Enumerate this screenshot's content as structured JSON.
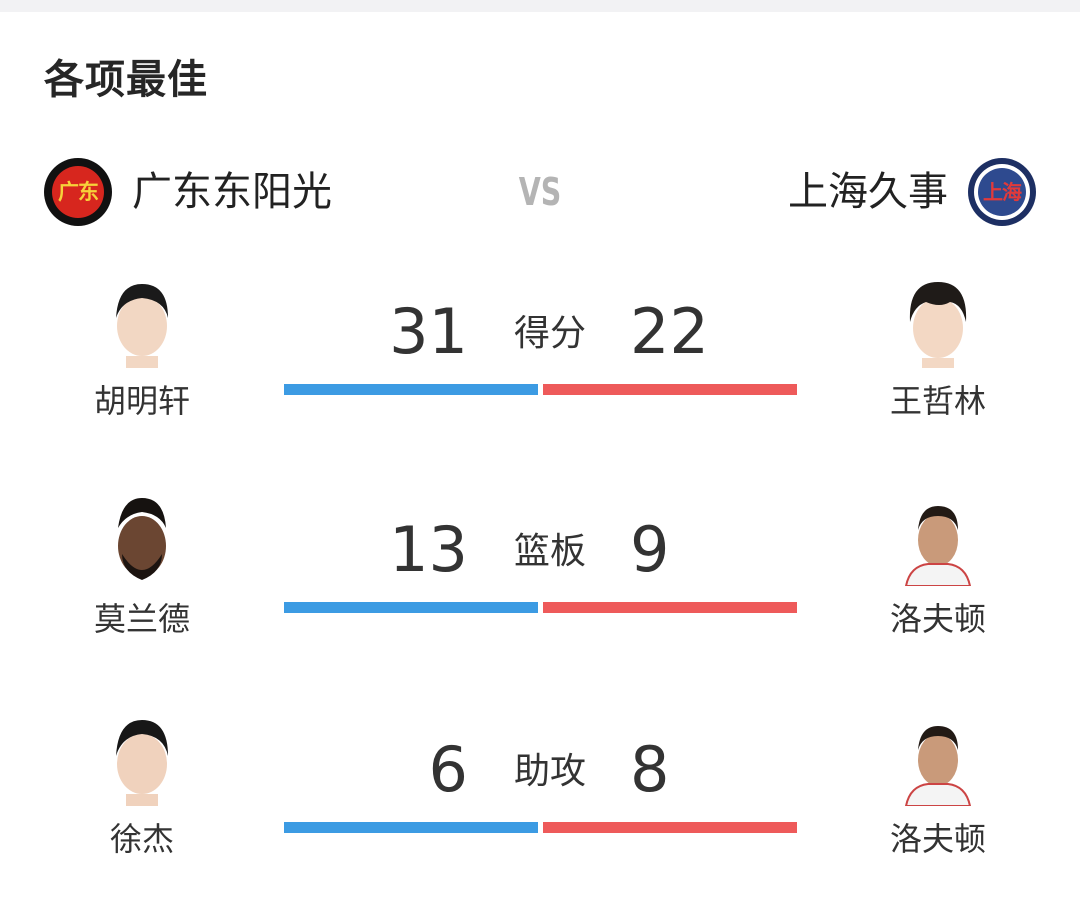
{
  "section": {
    "title": "各项最佳"
  },
  "teams": {
    "left": {
      "name": "广东东阳光",
      "logo_text": "广东",
      "color": "#d7261e"
    },
    "vs": "VS",
    "right": {
      "name": "上海久事",
      "logo_text": "上海",
      "color": "#1d2f63"
    }
  },
  "colors": {
    "left_bar": "#3c9be3",
    "right_bar": "#ee5a5a"
  },
  "stats": [
    {
      "label": "得分",
      "left_value": "31",
      "right_value": "22",
      "left_player": "胡明轩",
      "right_player": "王哲林"
    },
    {
      "label": "篮板",
      "left_value": "13",
      "right_value": "9",
      "left_player": "莫兰德",
      "right_player": "洛夫顿"
    },
    {
      "label": "助攻",
      "left_value": "6",
      "right_value": "8",
      "left_player": "徐杰",
      "right_player": "洛夫顿"
    }
  ]
}
